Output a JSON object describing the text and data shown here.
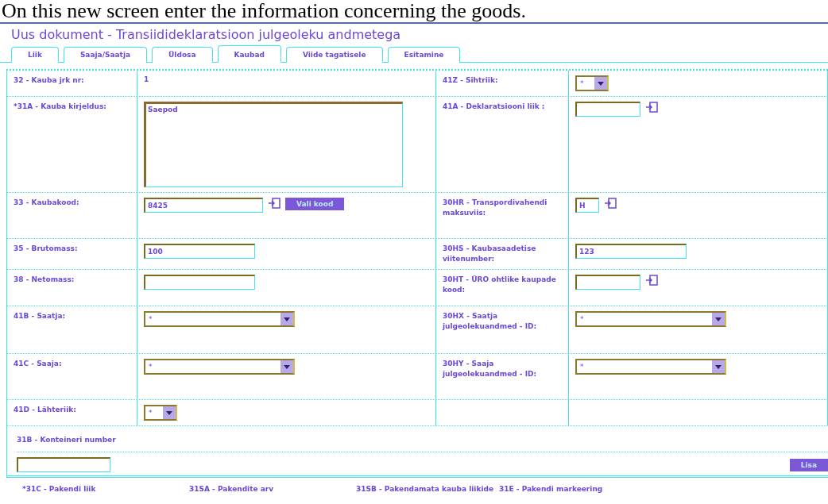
{
  "caption": "On this new screen enter the information concerning the goods.",
  "title": "Uus dokument - Transiidideklaratsioon julgeoleku andmetega",
  "tabs": [
    {
      "label": "Liik",
      "selected": false
    },
    {
      "label": "Saaja/Saatja",
      "selected": false
    },
    {
      "label": "Üldosa",
      "selected": false
    },
    {
      "label": "Kaubad",
      "selected": true
    },
    {
      "label": "Viide tagatisele",
      "selected": false
    },
    {
      "label": "Esitamine",
      "selected": false
    }
  ],
  "rows": [
    {
      "left": {
        "label": "32 - Kauba jrk nr:",
        "field": {
          "kind": "value",
          "value": "1"
        }
      },
      "right": {
        "label": "41Z - Sihtriik:",
        "field": {
          "kind": "select_short",
          "value": "*"
        }
      }
    },
    {
      "left": {
        "label": "*31A - Kauba kirjeldus:",
        "field": {
          "kind": "textarea",
          "value": "Saepod"
        }
      },
      "right": {
        "label": "41A - Deklaratsiooni liik :",
        "field": {
          "kind": "lookup"
        }
      }
    },
    {
      "left": {
        "label": "33 - Kaubakood:",
        "field": {
          "kind": "lookup_button",
          "value": "8425",
          "button": "Vali kood"
        }
      },
      "right": {
        "label": "30HR - Transpordivahendi maksuviis:",
        "field": {
          "kind": "code_lookup",
          "value": "H"
        }
      }
    },
    {
      "left": {
        "label": "35 - Brutomass:",
        "field": {
          "kind": "input",
          "value": "100"
        }
      },
      "right": {
        "label": "30HS - Kaubasaadetise viitenumber:",
        "field": {
          "kind": "input",
          "value": "123"
        }
      }
    },
    {
      "left": {
        "label": "38 - Netomass:",
        "field": {
          "kind": "input"
        }
      },
      "right": {
        "label": "30HT - ÜRO ohtlike kaupade kood:",
        "field": {
          "kind": "lookup"
        }
      }
    },
    {
      "left": {
        "label": "41B - Saatja:",
        "field": {
          "kind": "select",
          "value": "*"
        }
      },
      "right": {
        "label": "30HX - Saatja julgeolekuandmed - ID:",
        "field": {
          "kind": "select",
          "value": "*"
        }
      }
    },
    {
      "left": {
        "label": "41C - Saaja:",
        "field": {
          "kind": "select",
          "value": "*"
        }
      },
      "right": {
        "label": "30HY - Saaja julgeolekuandmed - ID:",
        "field": {
          "kind": "select",
          "value": "*"
        }
      }
    },
    {
      "left": {
        "label": "41D - Lähteriik:",
        "field": {
          "kind": "select_short",
          "value": "*"
        }
      }
    }
  ],
  "container": {
    "label": "31B - Konteineri number",
    "button": "Lisa"
  },
  "columns": [
    "*31C - Pakendi liik",
    "31SA - Pakendite arv",
    "31SB - Pakendamata kauba liikide",
    "31E - Pakendi markeering"
  ]
}
